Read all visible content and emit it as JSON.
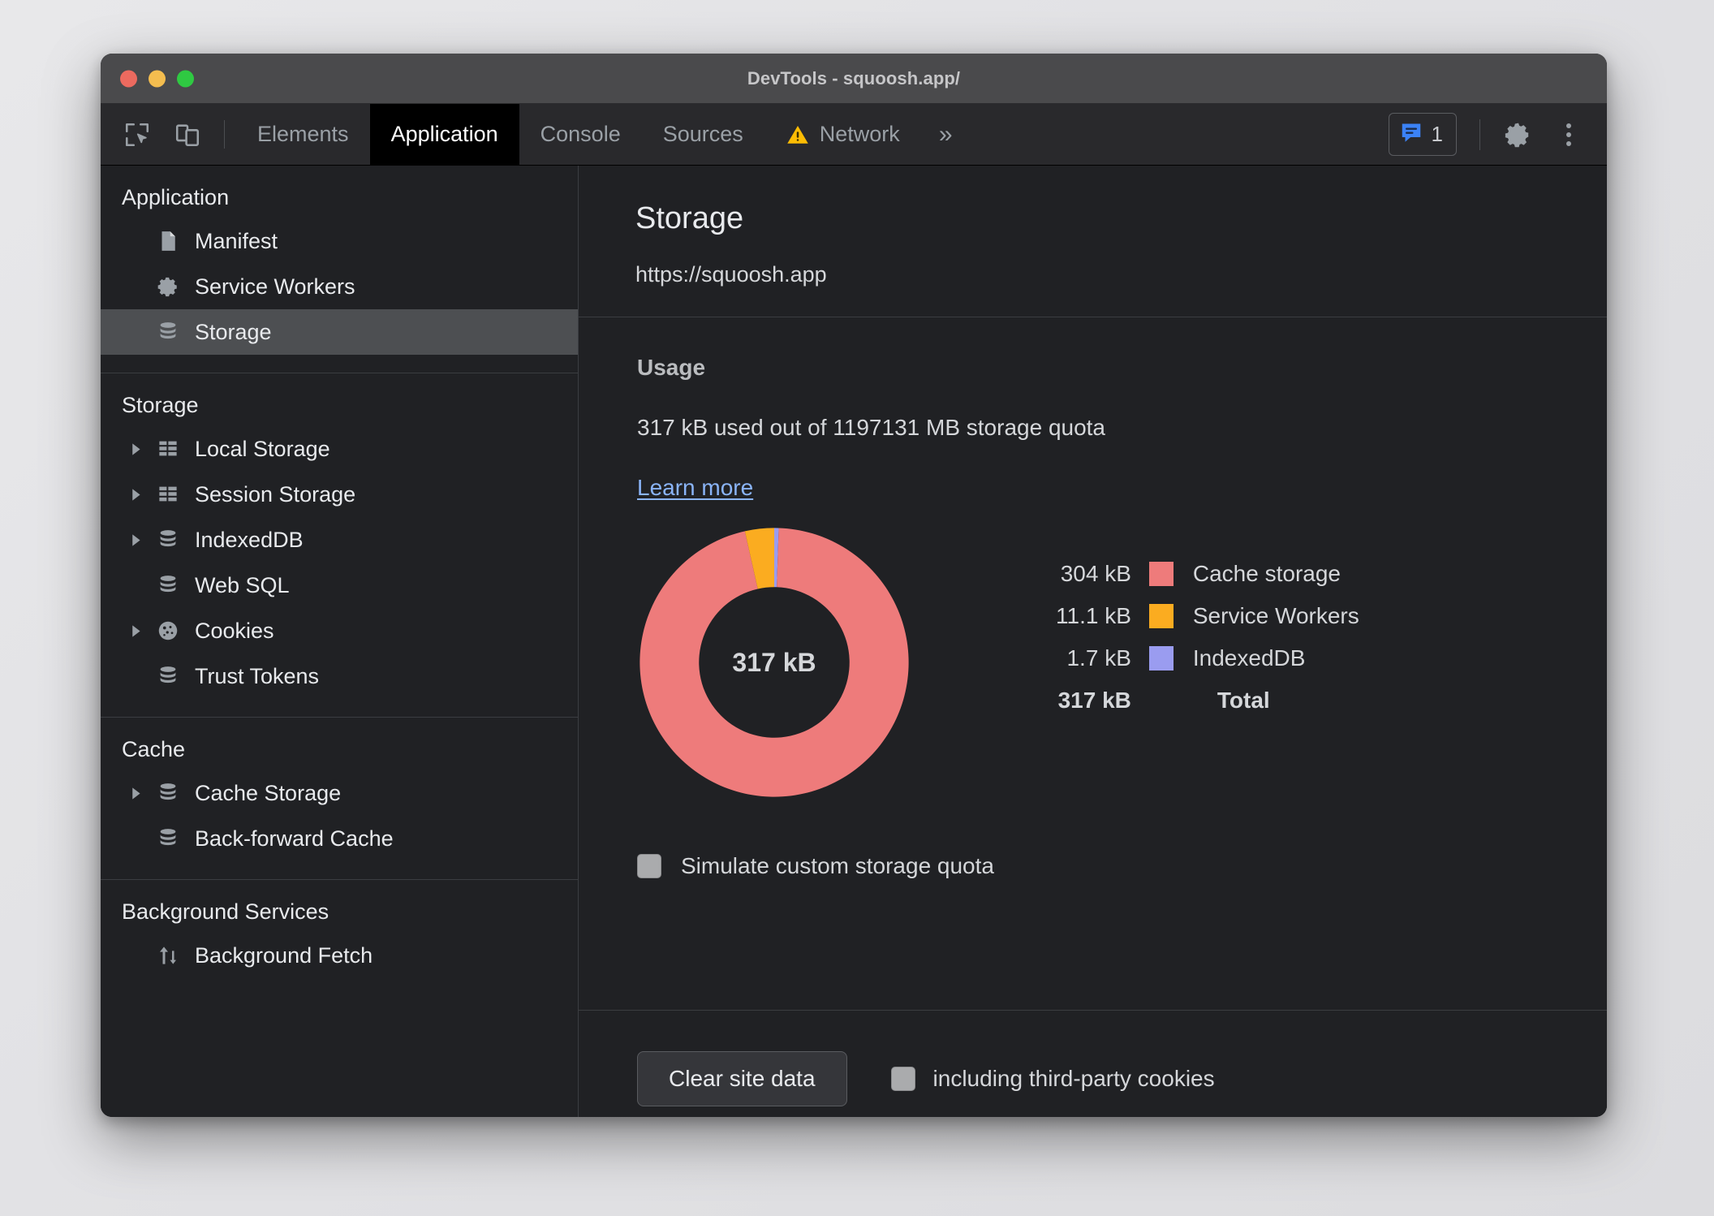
{
  "window": {
    "title": "DevTools - squoosh.app/",
    "traffic_lights": [
      "close",
      "minimize",
      "maximize"
    ]
  },
  "tabbar": {
    "tools": [
      {
        "name": "inspect-element-icon",
        "label": "Inspect"
      },
      {
        "name": "device-toolbar-icon",
        "label": "Toggle device toolbar"
      }
    ],
    "tabs": [
      {
        "label": "Elements",
        "active": false,
        "warning": false
      },
      {
        "label": "Application",
        "active": true,
        "warning": false
      },
      {
        "label": "Console",
        "active": false,
        "warning": false
      },
      {
        "label": "Sources",
        "active": false,
        "warning": false
      },
      {
        "label": "Network",
        "active": false,
        "warning": true
      }
    ],
    "more_tabs": "»",
    "message_count": "1",
    "settings_icon": "gear-icon",
    "menu_icon": "kebab-menu-icon"
  },
  "sidebar": {
    "sections": [
      {
        "title": "Application",
        "items": [
          {
            "label": "Manifest",
            "icon": "document-icon",
            "expandable": false,
            "selected": false
          },
          {
            "label": "Service Workers",
            "icon": "gear-icon",
            "expandable": false,
            "selected": false
          },
          {
            "label": "Storage",
            "icon": "database-icon",
            "expandable": false,
            "selected": true
          }
        ]
      },
      {
        "title": "Storage",
        "items": [
          {
            "label": "Local Storage",
            "icon": "table-icon",
            "expandable": true,
            "selected": false
          },
          {
            "label": "Session Storage",
            "icon": "table-icon",
            "expandable": true,
            "selected": false
          },
          {
            "label": "IndexedDB",
            "icon": "database-icon",
            "expandable": true,
            "selected": false
          },
          {
            "label": "Web SQL",
            "icon": "database-icon",
            "expandable": false,
            "selected": false
          },
          {
            "label": "Cookies",
            "icon": "cookie-icon",
            "expandable": true,
            "selected": false
          },
          {
            "label": "Trust Tokens",
            "icon": "database-icon",
            "expandable": false,
            "selected": false
          }
        ]
      },
      {
        "title": "Cache",
        "items": [
          {
            "label": "Cache Storage",
            "icon": "database-icon",
            "expandable": true,
            "selected": false
          },
          {
            "label": "Back-forward Cache",
            "icon": "database-icon",
            "expandable": false,
            "selected": false
          }
        ]
      },
      {
        "title": "Background Services",
        "items": [
          {
            "label": "Background Fetch",
            "icon": "updown-arrows-icon",
            "expandable": false,
            "selected": false
          }
        ]
      }
    ]
  },
  "panel": {
    "title": "Storage",
    "origin": "https://squoosh.app",
    "usage_heading": "Usage",
    "usage_line": "317 kB used out of 1197131 MB storage quota",
    "learn_more": "Learn more",
    "simulate_quota_label": "Simulate custom storage quota",
    "simulate_quota_checked": false,
    "clear_site_data_label": "Clear site data",
    "third_party_label": "including third-party cookies",
    "third_party_checked": false
  },
  "chart_data": {
    "type": "pie",
    "title": "Storage usage breakdown",
    "center_label": "317 kB",
    "categories": [
      "Cache storage",
      "Service Workers",
      "IndexedDB"
    ],
    "values": [
      304,
      11.1,
      1.7
    ],
    "value_labels": [
      "304 kB",
      "11.1 kB",
      "1.7 kB"
    ],
    "unit": "kB",
    "colors": [
      "#ee7b7b",
      "#fbac20",
      "#9a9cf0"
    ],
    "total_value": 316.8,
    "total_label": "317 kB",
    "total_name": "Total",
    "legend_position": "right",
    "donut": true,
    "inner_radius_ratio": 0.56
  }
}
